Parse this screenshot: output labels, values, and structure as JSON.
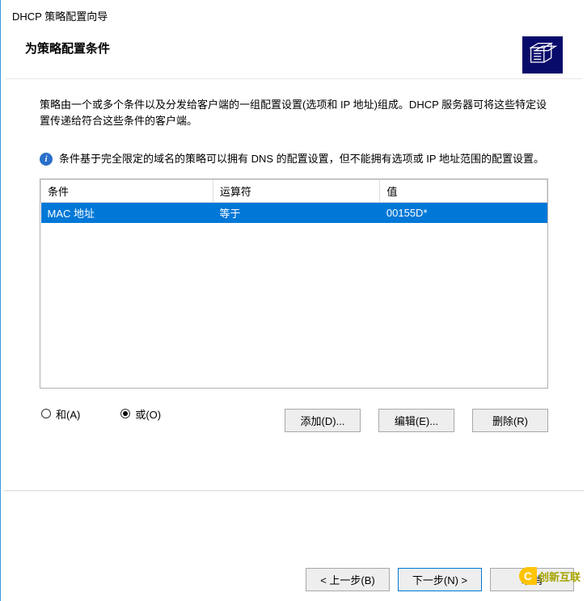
{
  "window": {
    "title": "DHCP 策略配置向导"
  },
  "header": {
    "title": "为策略配置条件",
    "icon": "dhcp-wizard-icon"
  },
  "body": {
    "description": "策略由一个或多个条件以及分发给客户端的一组配置设置(选项和 IP 地址)组成。DHCP 服务器可将这些特定设置传递给符合这些条件的客户端。",
    "info_text": "条件基于完全限定的域名的策略可以拥有 DNS 的配置设置，但不能拥有选项或 IP 地址范围的配置设置。"
  },
  "table": {
    "headers": {
      "c1": "条件",
      "c2": "运算符",
      "c3": "值"
    },
    "rows": [
      {
        "c1": "MAC 地址",
        "c2": "等于",
        "c3": "00155D*",
        "selected": true
      }
    ]
  },
  "radios": {
    "and": {
      "label": "和(A)",
      "checked": false
    },
    "or": {
      "label": "或(O)",
      "checked": true
    }
  },
  "buttons": {
    "add": "添加(D)...",
    "edit": "编辑(E)...",
    "delete": "删除(R)",
    "back": "< 上一步(B)",
    "next": "下一步(N) >",
    "cancel": "取消"
  },
  "watermark": {
    "text": "创新互联"
  }
}
